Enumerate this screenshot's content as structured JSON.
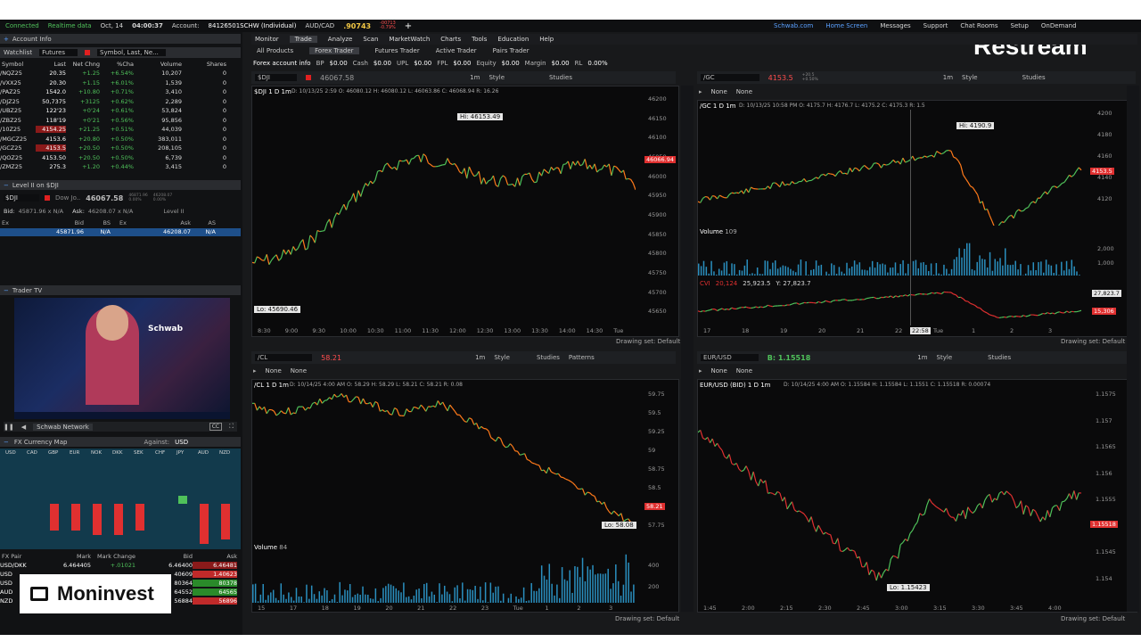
{
  "top": {
    "connected": "Connected",
    "realtime": "Realtime data",
    "date": "Oct, 14",
    "time": "04:00:37",
    "account_label": "Account:",
    "account": "84126501SCHW (Individual)",
    "pair": "AUD/CAD",
    "pair_price": ".90743",
    "pair_chg1": "-00713",
    "pair_chg2": "-0.79%",
    "add": "+",
    "links": [
      "Schwab.com",
      "Home Screen",
      "Messages",
      "Support",
      "Chat Rooms",
      "Setup"
    ],
    "ondemand": "OnDemand"
  },
  "restream": "Restream",
  "brand": "Moninvest",
  "menu": {
    "tabs": [
      "Monitor",
      "Trade",
      "Analyze",
      "Scan",
      "MarketWatch",
      "Charts",
      "Tools",
      "Education",
      "Help"
    ],
    "subtabs": [
      "All Products",
      "Forex Trader",
      "Futures Trader",
      "Active Trader",
      "Pairs Trader"
    ],
    "account_info": "Forex account info",
    "bp_label": "BP",
    "bp": "$0.00",
    "cash_label": "Cash",
    "cash": "$0.00",
    "upl_label": "UPL",
    "upl": "$0.00",
    "fpl_label": "FPL",
    "fpl": "$0.00",
    "equity_label": "Equity",
    "equity": "$0.00",
    "margin_label": "Margin",
    "margin": "$0.00",
    "rl_label": "RL",
    "rl": "0.00%"
  },
  "left": {
    "account_info": "Account Info",
    "watchlist": "Watchlist",
    "futures": "Futures",
    "symbol_search": "Symbol, Last, Ne...",
    "columns": [
      "Symbol",
      "Last",
      "Net Chng",
      "%Cha",
      "Volume",
      "Shares"
    ],
    "rows": [
      {
        "s": "/NQZ25",
        "l": "20.35",
        "n": "+1.25",
        "p": "+6.54%",
        "v": "10,207",
        "sh": "0"
      },
      {
        "s": "/VXX25",
        "l": "20.30",
        "n": "+1.15",
        "p": "+6.01%",
        "v": "1,539",
        "sh": "0"
      },
      {
        "s": "/PAZ25",
        "l": "1542.0",
        "n": "+10.80",
        "p": "+0.71%",
        "v": "3,410",
        "sh": "0"
      },
      {
        "s": "/DJZ25",
        "l": "50,7375",
        "n": "+3125",
        "p": "+0.62%",
        "v": "2,289",
        "sh": "0"
      },
      {
        "s": "/UBZ25",
        "l": "122'23",
        "n": "+0'24",
        "p": "+0.61%",
        "v": "53,824",
        "sh": "0"
      },
      {
        "s": "/ZBZ25",
        "l": "118'19",
        "n": "+0'21",
        "p": "+0.56%",
        "v": "95,856",
        "sh": "0"
      },
      {
        "s": "/10Z25",
        "l": "4154.25",
        "n": "+21.25",
        "p": "+0.51%",
        "v": "44,039",
        "sh": "0"
      },
      {
        "s": "/MGCZ25",
        "l": "4153.6",
        "n": "+20.80",
        "p": "+0.50%",
        "v": "383,011",
        "sh": "0"
      },
      {
        "s": "/GCZ25",
        "l": "4153.5",
        "n": "+20.50",
        "p": "+0.50%",
        "v": "208,105",
        "sh": "0"
      },
      {
        "s": "/QOZ25",
        "l": "4153.50",
        "n": "+20.50",
        "p": "+0.50%",
        "v": "6,739",
        "sh": "0"
      },
      {
        "s": "/ZMZ25",
        "l": "275.3",
        "n": "+1.20",
        "p": "+0.44%",
        "v": "3,415",
        "sh": "0"
      }
    ],
    "level2_title": "Level II on $DJI",
    "l2_symbol": "$DJI",
    "l2_name": "Dow Jo..",
    "l2_price": "46067.58",
    "l2_chg1": "46871.96",
    "l2_chg2": "0.00%",
    "l2_chg3": "46208.07",
    "l2_chg4": "0.00%",
    "bid_label": "Bid:",
    "bid": "45871.96 x N/A",
    "ask_label": "Ask:",
    "ask": "46208.07 x N/A",
    "level": "Level II",
    "l2_cols": [
      "Ex",
      "Bid",
      "BS",
      "Ex",
      "Ask",
      "AS"
    ],
    "l2_row": [
      "",
      "45871.96",
      "N/A",
      "",
      "46208.07",
      "N/A"
    ],
    "tradertv": "Trader TV",
    "schwab": "Schwab",
    "network": "Schwab Network",
    "cc": "CC",
    "fxmap": "FX Currency Map",
    "against": "Against:",
    "against_val": "USD",
    "currencies": [
      "USD",
      "CAD",
      "GBP",
      "EUR",
      "NOK",
      "DKK",
      "SEK",
      "CHF",
      "JPY",
      "AUD",
      "NZD"
    ],
    "fx_cols": [
      "FX Pair",
      "Mark",
      "Mark Change",
      "Bid",
      "Ask"
    ],
    "fx_rows": [
      {
        "p": "USD/DKK",
        "m": "6.464405",
        "c": "+.01021",
        "b": "6.46400",
        "a": "6.46481"
      },
      {
        "p": "USD",
        "m": "",
        "c": "",
        "b": "40609",
        "a": "1.40623"
      },
      {
        "p": "USD",
        "m": "",
        "c": "",
        "b": "80364",
        "a": "80378"
      },
      {
        "p": "AUD",
        "m": "",
        "c": "",
        "b": "64552",
        "a": "64565"
      },
      {
        "p": "NZD",
        "m": "",
        "c": "",
        "b": "56884",
        "a": "56896"
      }
    ]
  },
  "charts": {
    "dji": {
      "symbol": "$DJI",
      "price": "46067.58",
      "price_tag": "46066.94",
      "desc": "$DJI 1 D 1m",
      "ohlc": "D: 10/13/25 2:59 O: 46080.12 H: 46080.12 L: 46063.86 C: 46068.94 R: 16.26",
      "hi": "Hi: 46153.49",
      "lo": "Lo: 45690.46",
      "yticks": [
        "46200",
        "46150",
        "46100",
        "46050",
        "46000",
        "45950",
        "45900",
        "45850",
        "45800",
        "45750",
        "45700",
        "45650"
      ],
      "xticks": [
        "8:30",
        "9:00",
        "9:30",
        "10:00",
        "10:30",
        "11:00",
        "11:30",
        "12:00",
        "12:30",
        "13:00",
        "13:30",
        "14:00",
        "14:30",
        "Tue"
      ],
      "drawing": "Drawing set: Default"
    },
    "gc": {
      "symbol": "/GC",
      "price": "4153.5",
      "chg1": "+20.5",
      "chg2": "+0.50%",
      "desc": "/GC 1 D 1m",
      "ohlc": "D: 10/13/25 10:58 PM O: 4175.7 H: 4176.7 L: 4175.2 C: 4175.3 R: 1.5",
      "hi": "Hi: 4190.9",
      "price_tag": "4153.5",
      "yticks": [
        "4200",
        "4180",
        "4160",
        "4140",
        "4120"
      ],
      "volume": "Volume",
      "vol_val": "109",
      "vol_ticks": [
        "2,000",
        "1,000"
      ],
      "cvi": "CVI",
      "cvi_val": "20,124",
      "cvi_2": "25,923.5",
      "cvi_3": "Y: 27,823.7",
      "cvi_tag1": "27,823.7",
      "cvi_tag2": "15,306",
      "xticks": [
        "17",
        "18",
        "19",
        "20",
        "21",
        "22",
        "Tue",
        "1",
        "2",
        "3"
      ],
      "cursor_time": "22:58",
      "drawing": "Drawing set: Default"
    },
    "cl": {
      "symbol": "/CL",
      "price": "58.21",
      "desc": "/CL 1 D 1m",
      "ohlc": "D: 10/14/25 4:00 AM O: 58.29 H: 58.29 L: 58.21 C: 58.21 R: 0.08",
      "lo": "Lo: 58.08",
      "price_tag": "58.21",
      "yticks": [
        "59.75",
        "59.5",
        "59.25",
        "59",
        "58.75",
        "58.5",
        "58.25",
        "57.75"
      ],
      "volume": "Volume",
      "vol_val": "84",
      "vol_ticks": [
        "400",
        "200"
      ],
      "xticks": [
        "15",
        "17",
        "18",
        "19",
        "20",
        "21",
        "22",
        "23",
        "Tue",
        "1",
        "2",
        "3"
      ],
      "drawing": "Drawing set: Default"
    },
    "eur": {
      "symbol": "EUR/USD",
      "price": "B: 1.15518",
      "desc": "EUR/USD (BID) 1 D 1m",
      "ohlc": "D: 10/14/25 4:00 AM O: 1.15584 H: 1.15584 L: 1.1551 C: 1.15518 R: 0.00074",
      "lo": "Lo: 1.15423",
      "price_tag": "1.15518",
      "yticks": [
        "1.1575",
        "1.157",
        "1.1565",
        "1.156",
        "1.1555",
        "1.155",
        "1.1545",
        "1.154"
      ],
      "xticks": [
        "1:45",
        "2:00",
        "2:15",
        "2:30",
        "2:45",
        "3:00",
        "3:15",
        "3:30",
        "3:45",
        "4:00"
      ],
      "drawing": "Drawing set: Default"
    }
  },
  "toolbar_labels": {
    "style": "Style",
    "studies": "Studies",
    "patterns": "Patterns",
    "tf": "1m",
    "none": "None"
  }
}
